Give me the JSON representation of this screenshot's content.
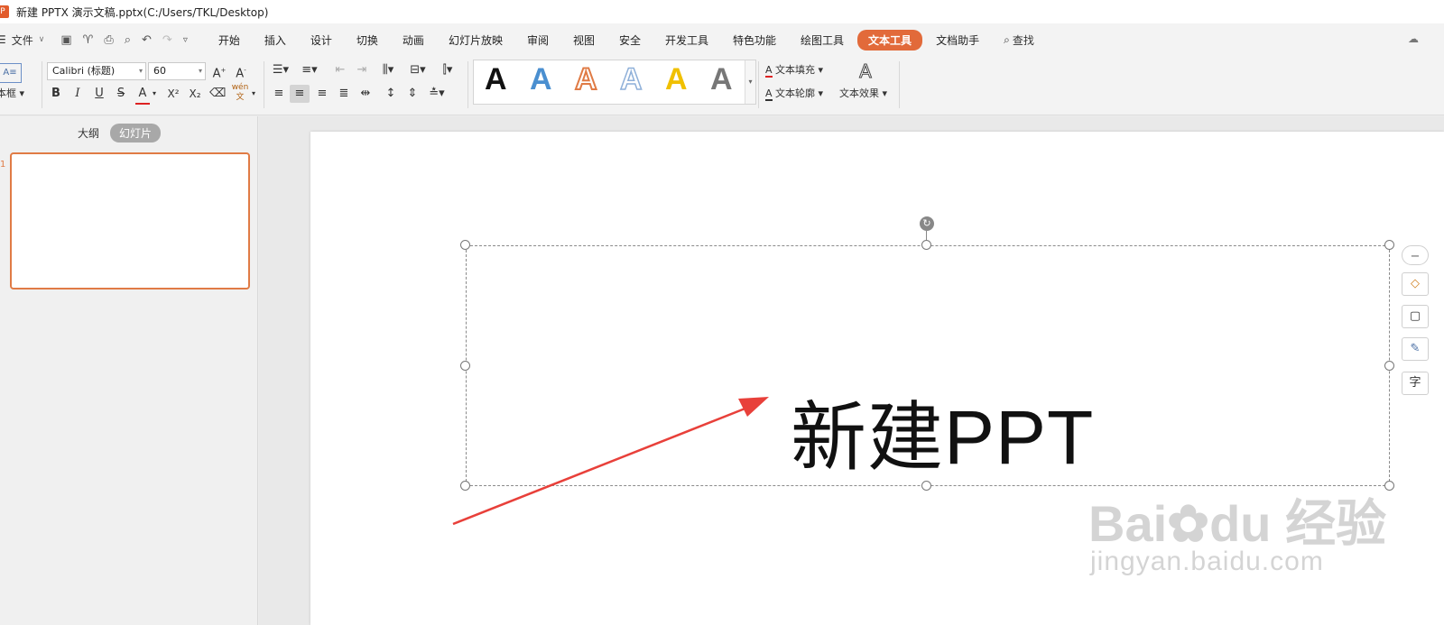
{
  "window": {
    "title": "新建 PPTX 演示文稿.pptx(C:/Users/TKL/Desktop)",
    "logo": "P"
  },
  "menubar": {
    "file_label": "文件",
    "tabs": [
      "开始",
      "插入",
      "设计",
      "切换",
      "动画",
      "幻灯片放映",
      "审阅",
      "视图",
      "安全",
      "开发工具",
      "特色功能",
      "绘图工具",
      "文本工具",
      "文档助手"
    ],
    "active_tab": "文本工具",
    "search_label": "查找"
  },
  "ribbon": {
    "textbox_label": "本框",
    "font_name": "Calibri (标题)",
    "font_size": "60",
    "format_buttons": [
      "B",
      "I",
      "U",
      "S",
      "A",
      "X²",
      "X₂"
    ],
    "pinyin_label": "wén",
    "text_fill_label": "文本填充",
    "text_outline_label": "文本轮廓",
    "text_effect_label": "文本效果",
    "style_letter": "A",
    "style_colors": [
      "#111111",
      "#4a8fd0",
      "#e07b45",
      "#8fb0d9",
      "#f0c000",
      "#777777"
    ]
  },
  "left_panel": {
    "outline_tab": "大纲",
    "slides_tab": "幻灯片",
    "slide_number": "1"
  },
  "slide": {
    "title_text": "新建PPT"
  },
  "side_tools": {
    "last_label": "字"
  },
  "watermark": {
    "brand_left": "Bai",
    "brand_right": "du",
    "brand_cn": "经验",
    "url": "jingyan.baidu.com"
  }
}
